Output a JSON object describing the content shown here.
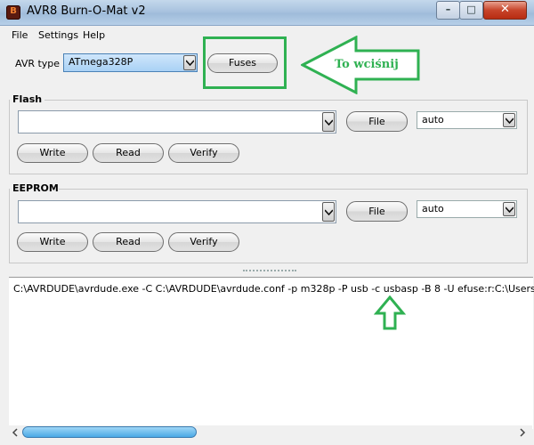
{
  "window": {
    "title": "AVR8 Burn-O-Mat v2",
    "app_icon_text": "B"
  },
  "menu": [
    "File",
    "Settings",
    "Help"
  ],
  "avr": {
    "label": "AVR type",
    "value": "ATmega328P",
    "fuses_button": "Fuses"
  },
  "flash": {
    "title": "Flash",
    "file_value": "",
    "file_button": "File",
    "format_value": "auto",
    "buttons": {
      "write": "Write",
      "read": "Read",
      "verify": "Verify"
    }
  },
  "eeprom": {
    "title": "EEPROM",
    "file_value": "",
    "file_button": "File",
    "format_value": "auto",
    "buttons": {
      "write": "Write",
      "read": "Read",
      "verify": "Verify"
    }
  },
  "log": {
    "text": "C:\\AVRDUDE\\avrdude.exe -C C:\\AVRDUDE\\avrdude.conf -p m328p -P usb -c usbasp -B 8 -U efuse:r:C:\\Users\\BARTek\\A"
  },
  "annotation": {
    "text": "To wciśnij",
    "color": "#2fb152"
  },
  "colors": {
    "titlebar": "#a9c3df",
    "scroll_thumb": "#4aa9e6",
    "close_button": "#c7442a"
  }
}
